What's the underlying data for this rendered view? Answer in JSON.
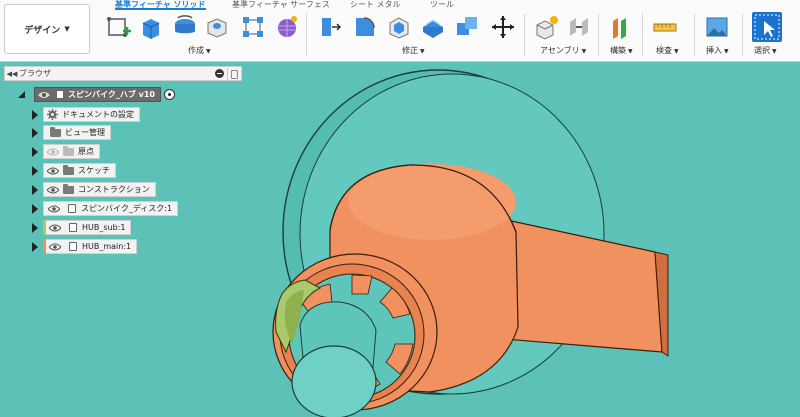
{
  "workspace": {
    "label": "デザイン"
  },
  "tabs": [
    {
      "label": "基準フィーチャ ソリッド",
      "active": true
    },
    {
      "label": "基準フィーチャ サーフェス",
      "active": false
    },
    {
      "label": "シート メタル",
      "active": false
    },
    {
      "label": "ツール",
      "active": false
    }
  ],
  "groups": {
    "create": "作成",
    "modify": "修正",
    "assemble": "アセンブリ",
    "construct": "構築",
    "inspect": "検査",
    "insert": "挿入",
    "select": "選択"
  },
  "browser": {
    "title": "ブラウザ",
    "root": "スピンバイク_ハブ v10",
    "items": [
      "ドキュメントの設定",
      "ビュー管理",
      "原点",
      "スケッチ",
      "コンストラクション",
      "スピンバイク_ディスク:1",
      "HUB_sub:1",
      "HUB_main:1"
    ]
  },
  "colors": {
    "viewport_bg": "#5cc2b7",
    "part_orange": "#f0915f",
    "part_teal": "#5ec5ba",
    "part_green": "#a9c96a",
    "accent_blue": "#1a7ed6"
  }
}
